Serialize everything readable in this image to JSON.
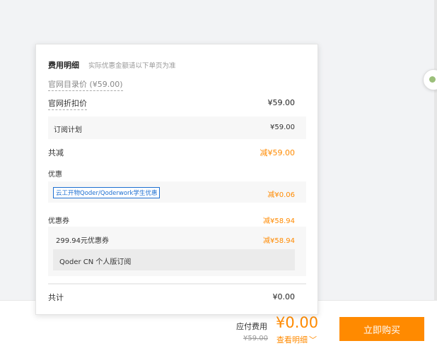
{
  "cost_panel": {
    "title": "费用明细",
    "subtitle": "实际优惠金额请以下单页为准",
    "list_price": "官网目录价 (¥59.00)",
    "discount_price_label": "官网折扣价",
    "discount_price_value": "¥59.00",
    "subscription_label": "订阅计划",
    "subscription_value": "¥59.00",
    "total_reduction_label": "共减",
    "total_reduction_value": "减¥59.00",
    "promo_heading": "优惠",
    "promo_tag": "云工开物Qoder/Qoderwork学生优惠",
    "promo_value": "减¥0.06",
    "coupon_heading": "优惠券",
    "coupon_heading_value": "减¥58.94",
    "coupon_name": "299.94元优惠券",
    "coupon_value": "减¥58.94",
    "coupon_product": "Qoder CN 个人版订阅",
    "sum_label": "共计",
    "sum_value": "¥0.00"
  },
  "footer": {
    "payable_label": "应付费用",
    "payable_amount": "¥0.00",
    "original_price": "¥59.00",
    "view_detail_label": "查看明细",
    "view_detail_icon": "chevron-down-icon",
    "buy_button_label": "立即购买"
  },
  "colors": {
    "accent": "#ff8a00",
    "tag_blue": "#1d6fd1"
  }
}
